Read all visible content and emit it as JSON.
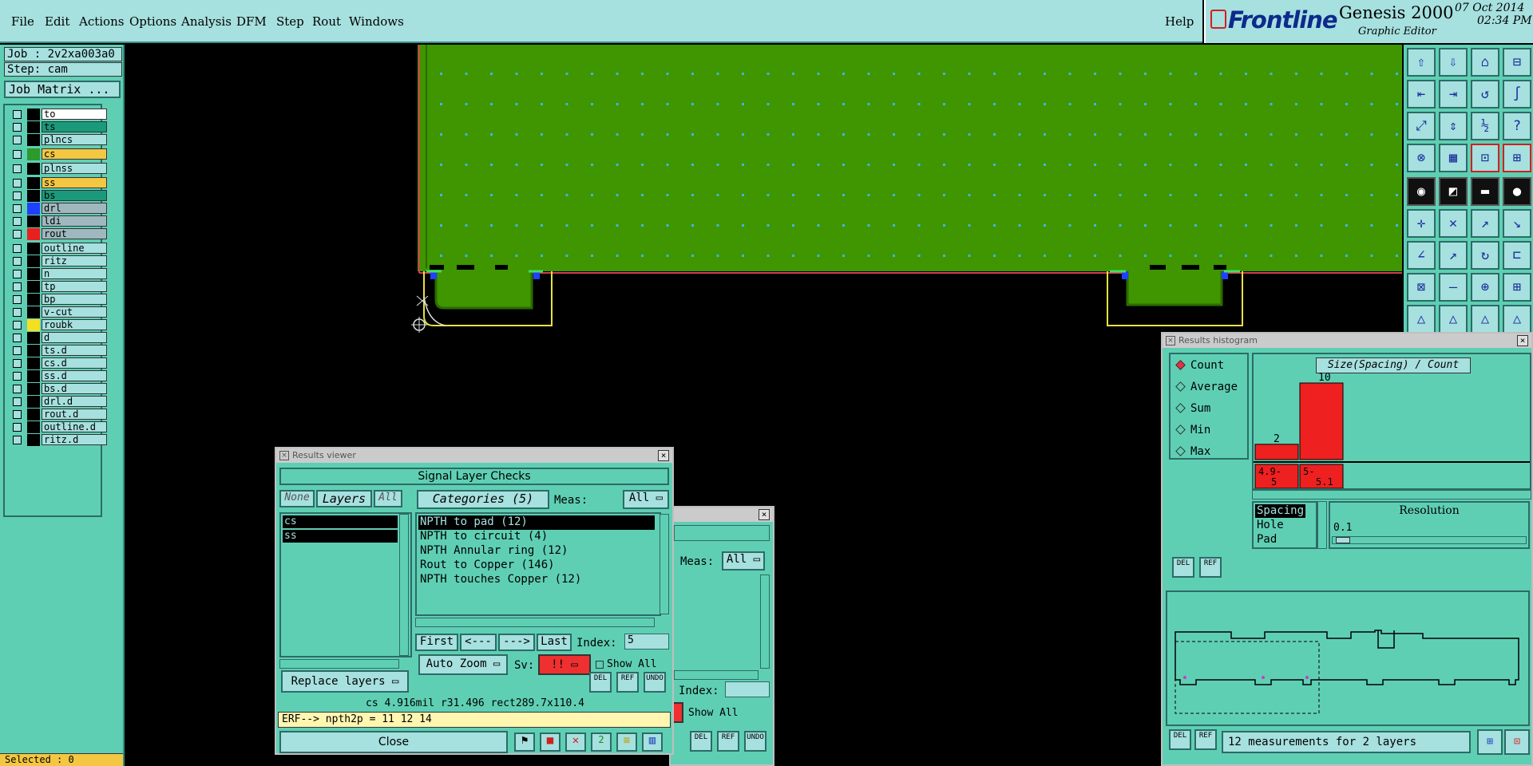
{
  "menubar": {
    "items": [
      "File",
      "Edit",
      "Actions",
      "Options",
      "Analysis",
      "DFM",
      "Step",
      "Rout",
      "Windows"
    ],
    "help": "Help"
  },
  "brand": {
    "logo": "Frontline",
    "product": "Genesis 2000",
    "subtitle": "Graphic Editor",
    "date": "07 Oct 2014",
    "time": "02:34 PM"
  },
  "left": {
    "job": "Job : 2v2xa003a0",
    "step": "Step: cam",
    "matrix_button": "Job Matrix ...",
    "layers": [
      {
        "name": "to",
        "color": "#ffffff",
        "swatch": "#000000"
      },
      {
        "name": "ts",
        "color": "#1a9a7a",
        "swatch": "#000000"
      },
      {
        "name": "plncs",
        "color": "#a6e0df",
        "swatch": "#000000"
      },
      {
        "name": "cs",
        "color": "#f4c742",
        "swatch": "#2d9a2d"
      },
      {
        "name": "plnss",
        "color": "#a6e0df",
        "swatch": "#000000"
      },
      {
        "name": "ss",
        "color": "#f4c742",
        "swatch": "#000000"
      },
      {
        "name": "bs",
        "color": "#1a9a7a",
        "swatch": "#000000"
      },
      {
        "name": "drl",
        "color": "#9fb8c0",
        "swatch": "#2040ff"
      },
      {
        "name": "ldi",
        "color": "#9fb8c0",
        "swatch": "#000000"
      },
      {
        "name": "rout",
        "color": "#9fb8c0",
        "swatch": "#e82020"
      },
      {
        "name": "outline",
        "color": "#a6e0df",
        "swatch": "#000000"
      },
      {
        "name": "ritz",
        "color": "#a6e0df",
        "swatch": "#000000"
      },
      {
        "name": "n",
        "color": "#a6e0df",
        "swatch": "#000000"
      },
      {
        "name": "tp",
        "color": "#a6e0df",
        "swatch": "#000000"
      },
      {
        "name": "bp",
        "color": "#a6e0df",
        "swatch": "#000000"
      },
      {
        "name": "v-cut",
        "color": "#a6e0df",
        "swatch": "#000000"
      },
      {
        "name": "roubk",
        "color": "#a6e0df",
        "swatch": "#f4e020"
      },
      {
        "name": "d",
        "color": "#a6e0df",
        "swatch": "#000000"
      },
      {
        "name": "ts.d",
        "color": "#a6e0df",
        "swatch": "#000000"
      },
      {
        "name": "cs.d",
        "color": "#a6e0df",
        "swatch": "#000000"
      },
      {
        "name": "ss.d",
        "color": "#a6e0df",
        "swatch": "#000000"
      },
      {
        "name": "bs.d",
        "color": "#a6e0df",
        "swatch": "#000000"
      },
      {
        "name": "drl.d",
        "color": "#a6e0df",
        "swatch": "#000000"
      },
      {
        "name": "rout.d",
        "color": "#a6e0df",
        "swatch": "#000000"
      },
      {
        "name": "outline.d",
        "color": "#a6e0df",
        "swatch": "#000000"
      },
      {
        "name": "ritz.d",
        "color": "#a6e0df",
        "swatch": "#000000"
      }
    ],
    "selected": "Selected : 0"
  },
  "results_viewer": {
    "title": "Results viewer",
    "heading": "Signal Layer Checks",
    "none": "None",
    "layers": "Layers",
    "all": "All",
    "categories_label": "Categories (5)",
    "meas_label": "Meas:",
    "meas_value": "All",
    "layer_list": [
      "cs",
      "ss"
    ],
    "categories": [
      "NPTH to pad (12)",
      "NPTH to circuit (4)",
      "NPTH Annular ring (12)",
      "Rout to Copper (146)",
      "NPTH touches Copper (12)"
    ],
    "first": "First",
    "prev": "<---",
    "next": "--->",
    "last": "Last",
    "index_label": "Index:",
    "index_value": "5",
    "auto_zoom": "Auto Zoom",
    "sv_label": "Sv:",
    "sv_value": "!!",
    "show_all": "Show All",
    "replace_layers": "Replace layers",
    "del": "DEL",
    "ref": "REF",
    "undo": "UNDO",
    "status": "cs 4.916mil  r31.496  rect289.7x110.4",
    "erf": "ERF--> npth2p = 11 12 14",
    "close": "Close"
  },
  "back_window": {
    "meas_label": "Meas:",
    "meas_value": "All",
    "index_label": "Index:",
    "show_all": "Show All",
    "del": "DEL",
    "ref": "REF",
    "undo": "UNDO"
  },
  "histogram": {
    "title": "Results histogram",
    "modes": [
      "Count",
      "Average",
      "Sum",
      "Min",
      "Max"
    ],
    "selected_mode": "Count",
    "chart_label": "Size(Spacing) / Count",
    "resolution_label": "Resolution",
    "resolution_value": "0.1",
    "types": [
      "Spacing",
      "Hole",
      "Pad"
    ],
    "selected_type": "Spacing",
    "del": "DEL",
    "ref": "REF",
    "footer": "12 measurements for 2 layers"
  },
  "chart_data": {
    "type": "bar",
    "categories": [
      "4.9-5",
      "5-5.1"
    ],
    "values": [
      2,
      10
    ],
    "title": "Size(Spacing) / Count",
    "color": "#ee2020"
  },
  "colors": {
    "board": "#3f9600",
    "hole": "#42b4e6",
    "panel": "#5fcfb4",
    "field": "#a6e0df"
  }
}
